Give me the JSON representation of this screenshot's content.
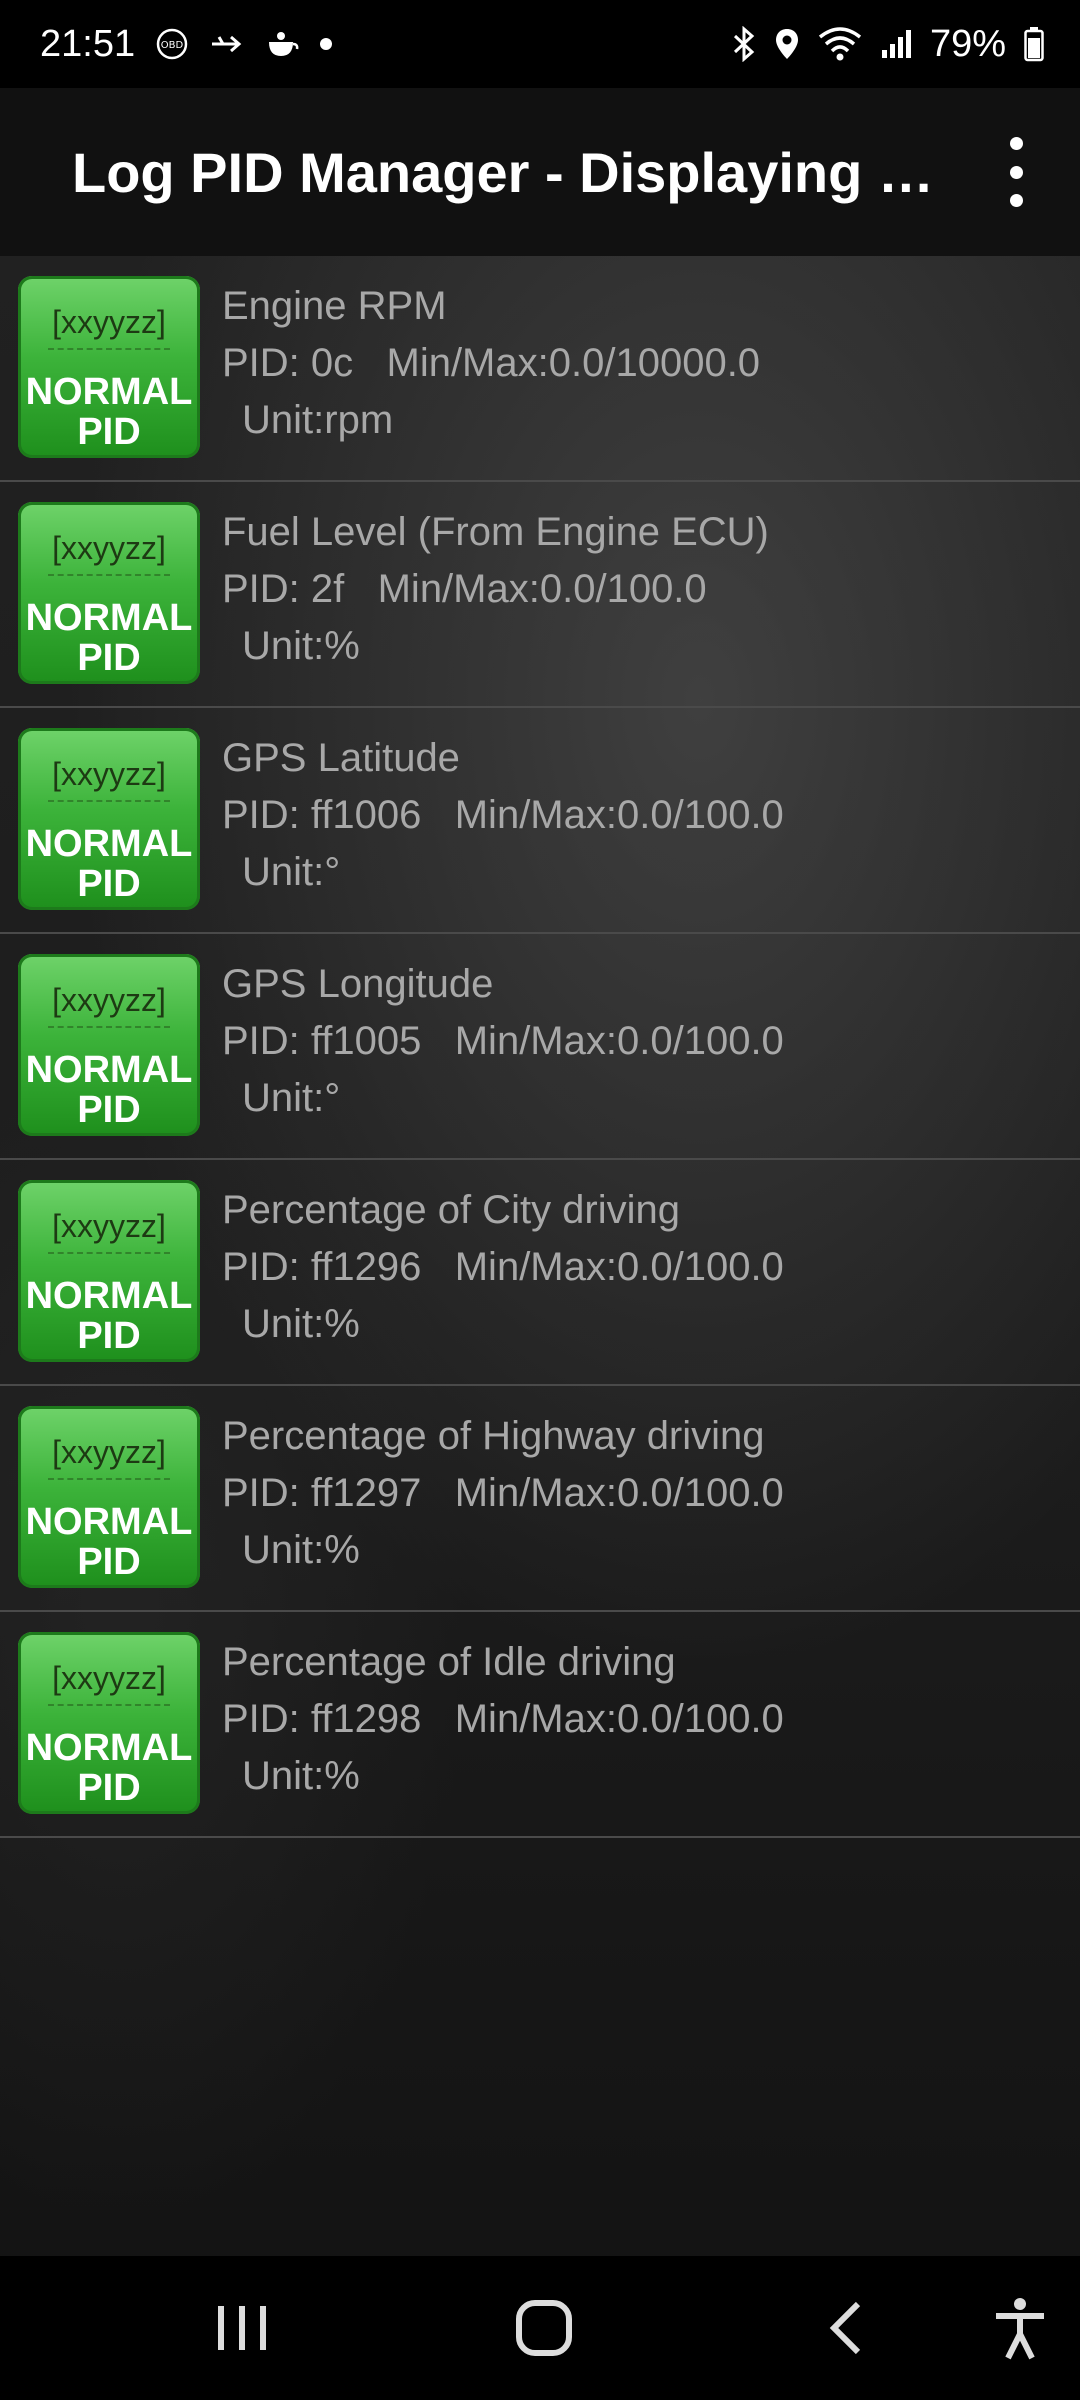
{
  "status_bar": {
    "time": "21:51",
    "battery_percent": "79%",
    "left_icons": [
      "obd-icon",
      "usb-icon",
      "teapot-icon",
      "dot-icon"
    ],
    "right_icons": [
      "bluetooth-icon",
      "location-icon",
      "wifi-icon",
      "signal-icon",
      "battery-icon"
    ]
  },
  "app_bar": {
    "title": "Log PID Manager - Displaying Log PIDs",
    "menu_icon": "more-vert-icon"
  },
  "badge": {
    "code": "[xxyyzz]",
    "type_line1": "NORMAL",
    "type_line2": "PID",
    "color": "#3cb33a"
  },
  "items": [
    {
      "name": "Engine RPM",
      "pid_line": "PID: 0c   Min/Max:0.0/10000.0",
      "unit": "Unit:rpm"
    },
    {
      "name": "Fuel Level (From Engine ECU)",
      "pid_line": "PID: 2f   Min/Max:0.0/100.0",
      "unit": "Unit:%"
    },
    {
      "name": "GPS Latitude",
      "pid_line": "PID: ff1006   Min/Max:0.0/100.0",
      "unit": "Unit:°"
    },
    {
      "name": "GPS Longitude",
      "pid_line": "PID: ff1005   Min/Max:0.0/100.0",
      "unit": "Unit:°"
    },
    {
      "name": "Percentage of City driving",
      "pid_line": "PID: ff1296   Min/Max:0.0/100.0",
      "unit": "Unit:%"
    },
    {
      "name": "Percentage of Highway driving",
      "pid_line": "PID: ff1297   Min/Max:0.0/100.0",
      "unit": "Unit:%"
    },
    {
      "name": "Percentage of Idle driving",
      "pid_line": "PID: ff1298   Min/Max:0.0/100.0",
      "unit": "Unit:%"
    }
  ],
  "nav_bar": {
    "icons": [
      "recent-apps-icon",
      "home-icon",
      "back-icon",
      "accessibility-icon"
    ]
  }
}
